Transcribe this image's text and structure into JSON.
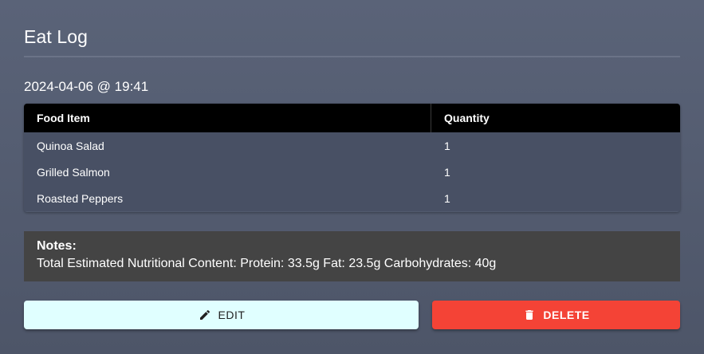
{
  "page": {
    "title": "Eat Log",
    "datetime": "2024-04-06 @ 19:41"
  },
  "table": {
    "headers": {
      "food": "Food Item",
      "quantity": "Quantity"
    },
    "rows": [
      {
        "food": "Quinoa Salad",
        "quantity": "1"
      },
      {
        "food": "Grilled Salmon",
        "quantity": "1"
      },
      {
        "food": "Roasted Peppers",
        "quantity": "1"
      }
    ]
  },
  "notes": {
    "title": "Notes:",
    "text": "Total Estimated Nutritional Content: Protein: 33.5g Fat: 23.5g Carbohydrates: 40g"
  },
  "actions": {
    "edit_label": "EDIT",
    "edit_icon": "pencil-icon",
    "delete_label": "DELETE",
    "delete_icon": "trash-icon"
  },
  "colors": {
    "background": "#545c70",
    "table_header": "#000000",
    "table_row": "#485064",
    "notes_bg": "#444444",
    "edit_bg": "#e0ffff",
    "delete_bg": "#f44336"
  }
}
